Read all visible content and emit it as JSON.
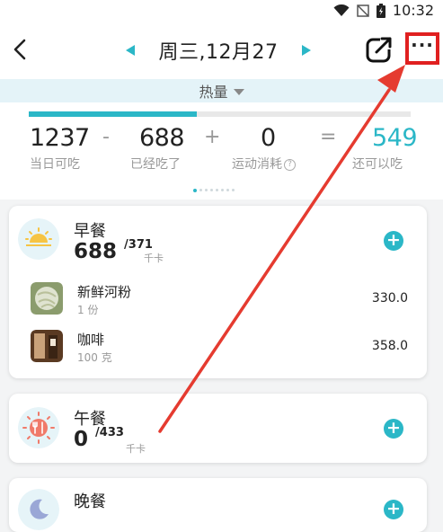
{
  "status": {
    "time": "10:32",
    "icons": [
      "wifi-icon",
      "signal-blocked-icon",
      "battery-charging-icon"
    ]
  },
  "header": {
    "date": "周三,12月27",
    "icons": [
      "back-icon",
      "prev-arrow-icon",
      "next-arrow-icon",
      "share-icon",
      "more-icon"
    ],
    "more_label": "···"
  },
  "tab": {
    "label": "热量"
  },
  "summary": {
    "progress": 0.44,
    "daily_allowed": {
      "value": "1237",
      "label": "当日可吃"
    },
    "eaten": {
      "value": "688",
      "label": "已经吃了"
    },
    "exercise": {
      "value": "0",
      "label": "运动消耗"
    },
    "remaining": {
      "value": "549",
      "label": "还可以吃"
    },
    "ops": [
      "-",
      "+",
      "="
    ],
    "page_dots": 8,
    "active_dot": 0
  },
  "breakfast": {
    "title": "早餐",
    "calories": "688",
    "target": "/371",
    "unit": "千卡",
    "items": [
      {
        "name": "新鲜河粉",
        "qty": "1 份",
        "cal": "330.0"
      },
      {
        "name": "咖啡",
        "qty": "100 克",
        "cal": "358.0"
      }
    ]
  },
  "lunch": {
    "title": "午餐",
    "calories": "0",
    "target": "/433",
    "unit": "千卡"
  },
  "dinner": {
    "title": "晚餐"
  },
  "colors": {
    "accent": "#2bb7c7",
    "annotation": "#e02020",
    "tab_bg": "#e4f3f8"
  }
}
